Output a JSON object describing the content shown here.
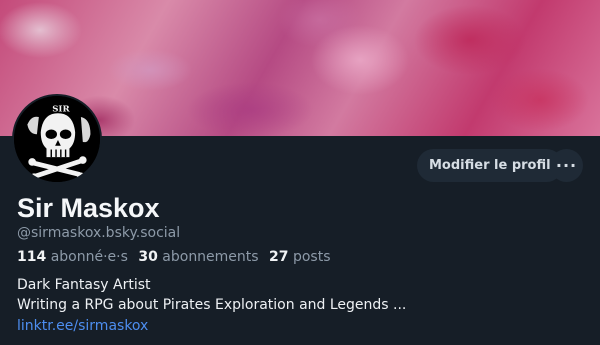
{
  "profile": {
    "display_name": "Sir Maskox",
    "handle": "@sirmaskox.bsky.social",
    "stats": {
      "followers_count": "114",
      "followers_label": "abonné·e·s",
      "following_count": "30",
      "following_label": "abonnements",
      "posts_count": "27",
      "posts_label": "posts"
    },
    "bio_line1": "Dark Fantasy Artist",
    "bio_line2": "Writing a RPG about Pirates Exploration and Legends ...",
    "link": "linktr.ee/sirmaskox"
  },
  "actions": {
    "edit_profile_label": "Modifier le profil",
    "more_icon": "ellipsis-icon"
  },
  "colors": {
    "background": "#161e27",
    "link": "#4d8ef0",
    "muted_text": "#8d9aa8",
    "button_bg": "#1f2a36"
  }
}
